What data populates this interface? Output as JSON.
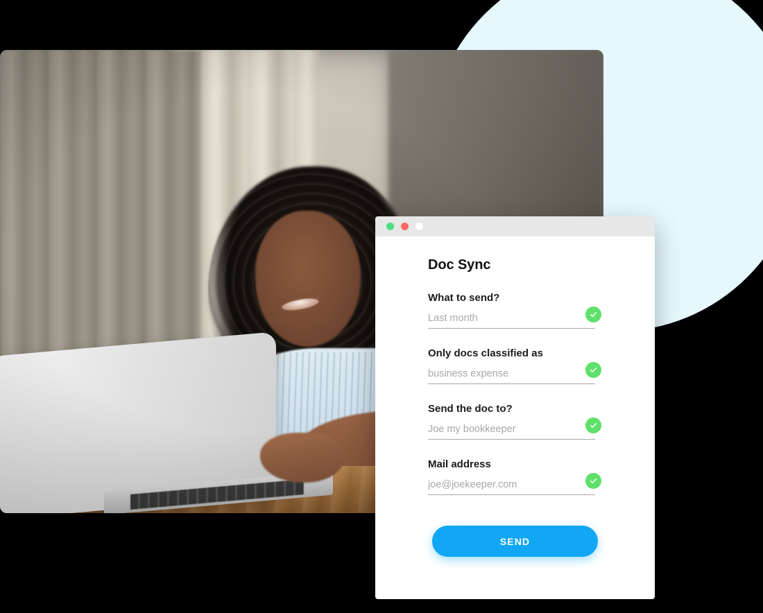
{
  "window": {
    "title": "Doc Sync",
    "traffic_lights": [
      {
        "name": "minimize-dot",
        "color": "#4dde7f"
      },
      {
        "name": "close-dot",
        "color": "#fb6a62"
      },
      {
        "name": "maximize-dot",
        "color": "#ffffff"
      }
    ]
  },
  "form": {
    "fields": [
      {
        "label": "What to send?",
        "placeholder": "Last month",
        "validated": true
      },
      {
        "label": "Only docs classified as",
        "placeholder": "business expense",
        "validated": true
      },
      {
        "label": "Send the doc to?",
        "placeholder": "Joe my bookkeeper",
        "validated": true
      },
      {
        "label": "Mail address",
        "placeholder": "joe@joekeeper.com",
        "validated": true
      }
    ],
    "submit_label": "SEND"
  },
  "photo": {
    "alt": "Woman with curly hair smiling while typing on a silver laptop at a wooden desk near a bright curtained window, with a notebook beside her"
  },
  "colors": {
    "accent_blue": "#12a7f5",
    "validation_green": "#5fe06a",
    "titlebar_grey": "#e7e7e7",
    "decor_circle": "#e6f7fd",
    "page_background": "#000000"
  }
}
